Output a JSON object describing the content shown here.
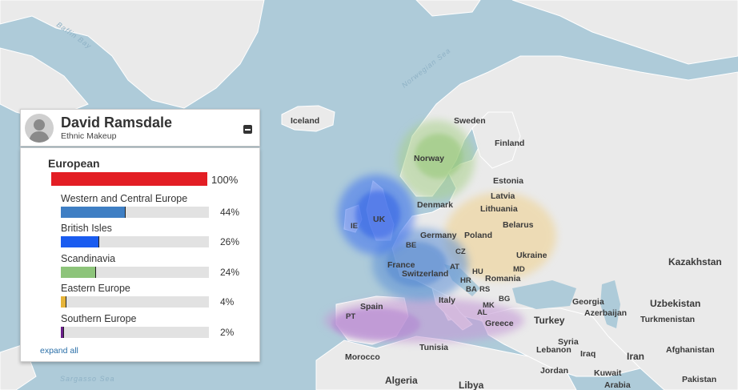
{
  "profile": {
    "name": "David Ramsdale",
    "subtitle": "Ethnic Makeup"
  },
  "region": {
    "name": "European",
    "percent": "100%",
    "color": "#e31e24"
  },
  "breakdown": [
    {
      "label": "Western and Central Europe",
      "percent": "44%",
      "value": 44,
      "color": "#3f7fc4"
    },
    {
      "label": "British Isles",
      "percent": "26%",
      "value": 26,
      "color": "#1a5cf0"
    },
    {
      "label": "Scandinavia",
      "percent": "24%",
      "value": 24,
      "color": "#8dc47a"
    },
    {
      "label": "Eastern Europe",
      "percent": "4%",
      "value": 4,
      "color": "#e6b43a"
    },
    {
      "label": "Southern Europe",
      "percent": "2%",
      "value": 2,
      "color": "#6a1f8a"
    }
  ],
  "expand_label": "expand all",
  "map": {
    "countries": {
      "iceland": "Iceland",
      "sweden": "Sweden",
      "finland": "Finland",
      "norway": "Norway",
      "estonia": "Estonia",
      "latvia": "Latvia",
      "lithuania": "Lithuania",
      "denmark": "Denmark",
      "uk": "UK",
      "ie": "IE",
      "be": "BE",
      "germany": "Germany",
      "poland": "Poland",
      "belarus": "Belarus",
      "cz": "CZ",
      "france": "France",
      "at": "AT",
      "switzerland": "Switzerland",
      "hu": "HU",
      "ukraine": "Ukraine",
      "md": "MD",
      "hr": "HR",
      "romania": "Romania",
      "ba": "BA",
      "rs": "RS",
      "bg": "BG",
      "italy": "Italy",
      "mk": "MK",
      "al": "AL",
      "greece": "Greece",
      "spain": "Spain",
      "pt": "PT",
      "turkey": "Turkey",
      "georgia": "Georgia",
      "azerbaijan": "Azerbaijan",
      "turkmenistan": "Turkmenistan",
      "uzbekistan": "Uzbekistan",
      "kazakhstan": "Kazakhstan",
      "syria": "Syria",
      "lebanon": "Lebanon",
      "iraq": "Iraq",
      "iran": "Iran",
      "afghanistan": "Afghanistan",
      "jordan": "Jordan",
      "kuwait": "Kuwait",
      "arabia": "Arabia",
      "pakistan": "Pakistan",
      "tunisia": "Tunisia",
      "morocco": "Morocco",
      "algeria": "Algeria",
      "libya": "Libya"
    },
    "seas": {
      "baffin": "Baffin Bay",
      "norwegian": "Norwegian Sea",
      "sargasso": "Sargasso Sea"
    }
  }
}
